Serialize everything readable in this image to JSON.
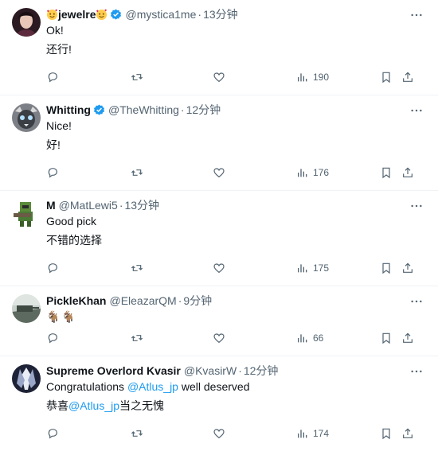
{
  "tweets": [
    {
      "name": "jewelre",
      "handle": "@mystica1me",
      "dot": "·",
      "time": "13分钟",
      "verified": true,
      "lines": [
        "Ok!",
        "还行!"
      ],
      "views": "190",
      "avatar_color": "#3a1f2a"
    },
    {
      "name": "Whitting",
      "handle": "@TheWhitting",
      "dot": "·",
      "time": "12分钟",
      "verified": true,
      "lines": [
        "Nice!",
        "好!"
      ],
      "views": "176",
      "avatar_color": "#6b6f78"
    },
    {
      "name": "M",
      "handle": "@MatLewi5",
      "dot": "·",
      "time": "13分钟",
      "verified": false,
      "lines": [
        "Good pick",
        "不错的选择"
      ],
      "views": "175",
      "avatar_color": "#4a7a35"
    },
    {
      "name": "PickleKhan",
      "handle": "@EleazarQM",
      "dot": "·",
      "time": "9分钟",
      "verified": false,
      "lines": [
        "🐐🐐"
      ],
      "views": "66",
      "avatar_color": "#7d8a83"
    },
    {
      "name": "Supreme Overlord Kvasir",
      "handle": "@KvasirW",
      "dot": "·",
      "time": "12分钟",
      "verified": false,
      "line1_prefix": "Congratulations ",
      "mention": "@Atlus_jp",
      "line1_suffix": " well deserved",
      "line2_prefix": "恭喜",
      "line2_suffix": "当之无愧",
      "views": "174",
      "avatar_color": "#2c3550"
    }
  ],
  "colors": {
    "text": "#0f1419",
    "secondary": "#536471",
    "link": "#1d9bf0",
    "verified": "#1d9bf0",
    "divider": "#eff3f4"
  },
  "icons": [
    "reply-icon",
    "retweet-icon",
    "like-icon",
    "views-icon",
    "bookmark-icon",
    "share-icon",
    "more-icon",
    "verified-badge-icon"
  ]
}
